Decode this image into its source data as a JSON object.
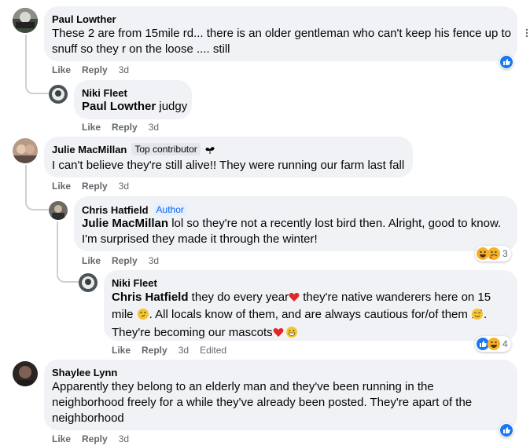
{
  "comments": [
    {
      "author": "Paul Lowther",
      "text": "These 2 are from 15mile rd... there is an older gentleman who can't keep his fence up to snuff so they r on the loose .... still",
      "like": "Like",
      "reply": "Reply",
      "time": "3d"
    },
    {
      "author": "Niki Fleet",
      "mention": "Paul Lowther",
      "text": " judgy",
      "like": "Like",
      "reply": "Reply",
      "time": "3d"
    },
    {
      "author": "Julie MacMillan",
      "badge": "Top contributor",
      "text": "I can't believe they're still alive!! They were running our farm last fall",
      "like": "Like",
      "reply": "Reply",
      "time": "3d"
    },
    {
      "author": "Chris Hatfield",
      "badge": "Author",
      "mention": "Julie MacMillan",
      "text": " lol so they're not a recently lost bird then. Alright, good to know. I'm surprised they made it through the winter!",
      "like": "Like",
      "reply": "Reply",
      "time": "3d",
      "reaction_count": "3"
    },
    {
      "author": "Niki Fleet",
      "mention": "Chris Hatfield",
      "text_a": " they do every year",
      "text_b": " they're native wanderers here on 15 mile ",
      "text_c": ". All locals know of them, and are always cautious for/of them ",
      "text_d": ". They're becoming our mascots",
      "like": "Like",
      "reply": "Reply",
      "time": "3d",
      "edited": "Edited",
      "reaction_count": "4"
    },
    {
      "author": "Shaylee Lynn",
      "text": "Apparently they belong to an elderly man and they've been running in the neighborhood freely for a while they've already been posted. They're apart of the neighborhood",
      "like": "Like",
      "reply": "Reply",
      "time": "3d"
    }
  ],
  "colors": {
    "like": "#1877f2",
    "author_badge": "#0866ff",
    "meta": "#65676b",
    "bubble": "#f0f2f5"
  }
}
